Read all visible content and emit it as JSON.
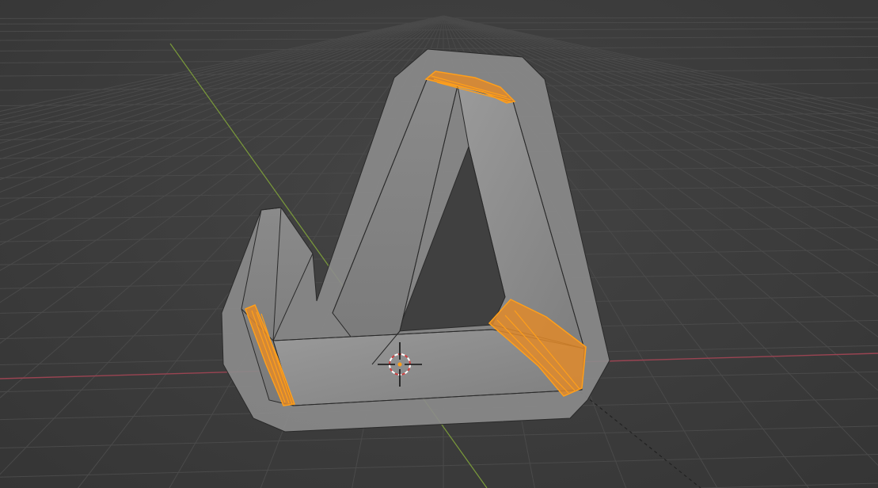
{
  "viewport": {
    "mode": "3d-viewport",
    "selection_mode": "edge",
    "background_color": "#3d3d3d",
    "grid_color": "#4a4a4a",
    "x_axis_color": "#9a4452",
    "y_axis_color": "#7a9a3a",
    "object_face_color": "#8c8c8c",
    "object_edge_color": "#2a2a2a",
    "selected_edge_color": "#ff9f1a",
    "selected_fill_color": "#e08a2a"
  },
  "cursor_3d": {
    "ring_colors": [
      "#ffffff",
      "#d04040"
    ]
  },
  "icons": {
    "cursor": "3d-cursor-icon",
    "origin": "object-origin-icon"
  }
}
